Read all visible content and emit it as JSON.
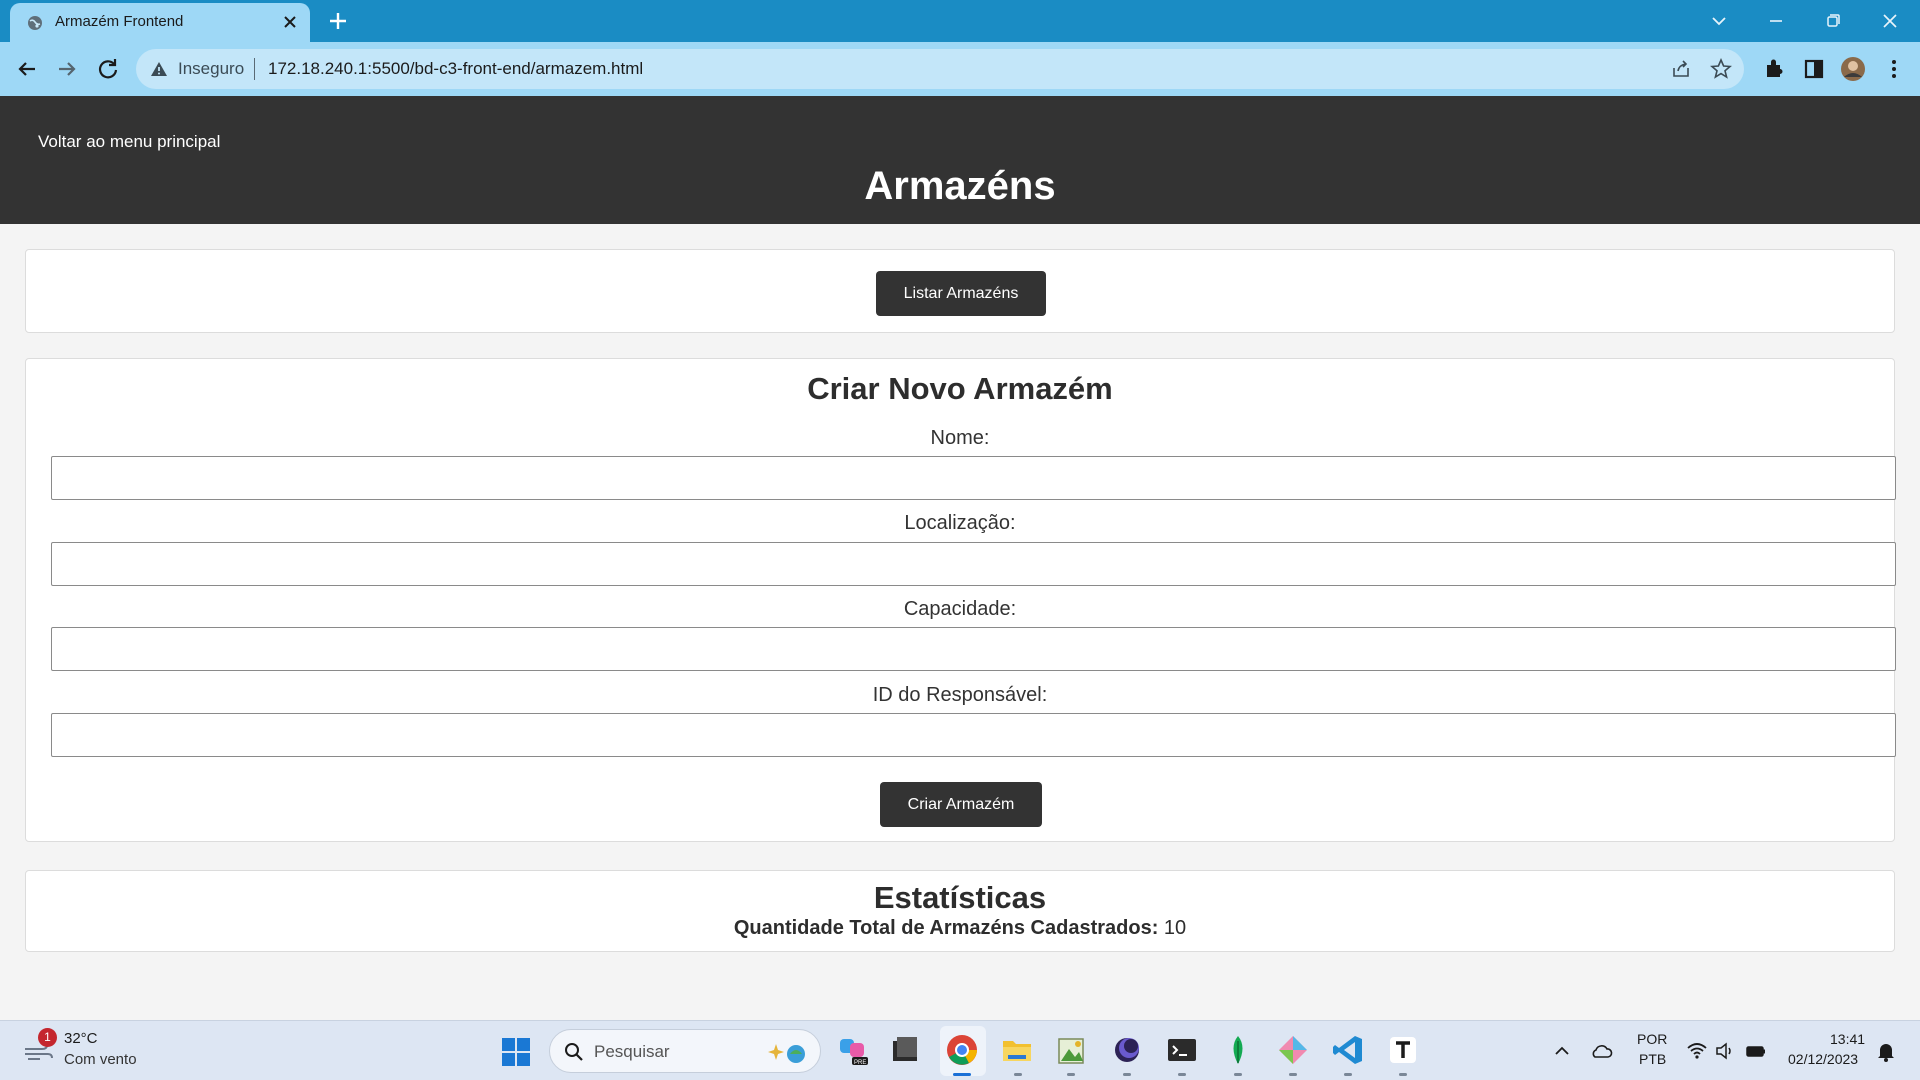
{
  "browser": {
    "tab_title": "Armazém Frontend",
    "security_label": "Inseguro",
    "url": "172.18.240.1:5500/bd-c3-front-end/armazem.html"
  },
  "header": {
    "back_link": "Voltar ao menu principal",
    "title": "Armazéns"
  },
  "list_section": {
    "button_label": "Listar Armazéns"
  },
  "create_form": {
    "title": "Criar Novo Armazém",
    "fields": [
      {
        "label": "Nome:",
        "value": ""
      },
      {
        "label": "Localização:",
        "value": ""
      },
      {
        "label": "Capacidade:",
        "value": ""
      },
      {
        "label": "ID do Responsável:",
        "value": ""
      }
    ],
    "submit_label": "Criar Armazém"
  },
  "stats": {
    "title": "Estatísticas",
    "total_label": "Quantidade Total de Armazéns Cadastrados:",
    "total_value": "10"
  },
  "taskbar": {
    "weather_badge": "1",
    "temperature": "32°C",
    "weather_desc": "Com vento",
    "search_placeholder": "Pesquisar",
    "language": "POR",
    "keyboard": "PTB",
    "time": "13:41",
    "date": "02/12/2023"
  },
  "icons": {
    "apps": [
      "copilot-icon",
      "app-icon",
      "chrome-icon",
      "file-explorer-icon",
      "photo-app-icon",
      "eclipse-icon",
      "terminal-icon",
      "mongodb-icon",
      "git-icon",
      "vscode-icon",
      "typora-icon"
    ]
  },
  "colors": {
    "tab_strip": "#1a8cc4",
    "toolbar": "#9ed8f6",
    "page_header": "#333333",
    "button": "#333333",
    "page_background": "#f4f4f4"
  }
}
